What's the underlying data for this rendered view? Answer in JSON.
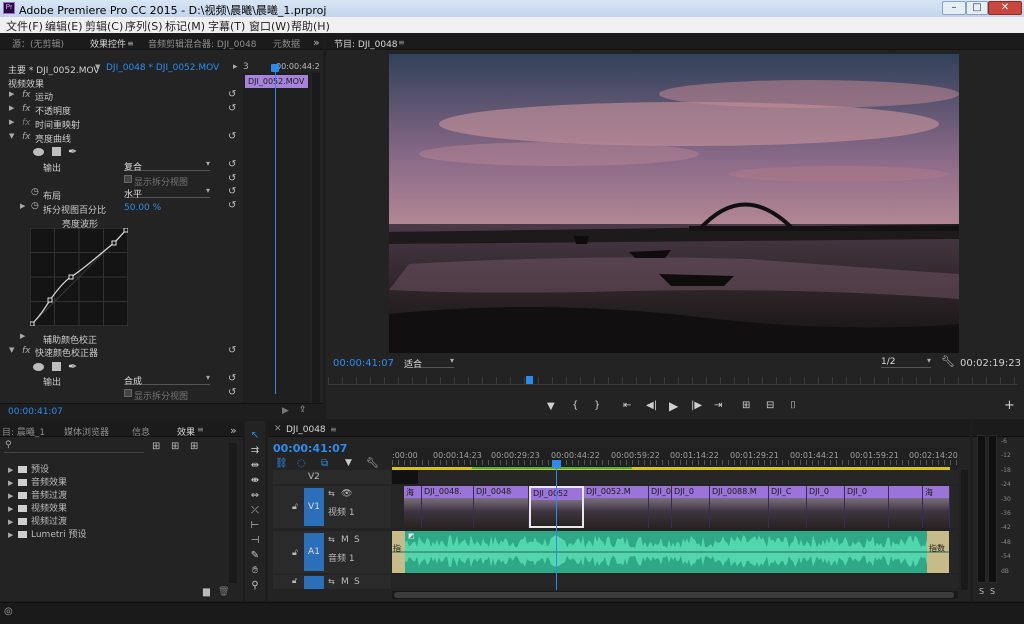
{
  "window": {
    "title": "Adobe Premiere Pro CC 2015 - D:\\视频\\晨曦\\晨曦_1.prproj",
    "app_icon": "Pr",
    "minimize": "–",
    "maximize": "□",
    "close": "✕"
  },
  "menu": [
    "文件(F)",
    "编辑(E)",
    "剪辑(C)",
    "序列(S)",
    "标记(M)",
    "字幕(T)",
    "窗口(W)",
    "帮助(H)"
  ],
  "effects_panel": {
    "tabs": [
      "源：(无剪辑)",
      "效果控件",
      "音频剪辑混合器: DJI_0048",
      "元数据"
    ],
    "overflow": "»",
    "master_label": "主要 * DJI_0052.MOV",
    "sequence_label": "DJI_0048 * DJI_0052.MOV",
    "ruler_start": "3",
    "ruler_time": "00:00:44:2",
    "clip_chip": "DJI_0052.MOV",
    "section": "视频效果",
    "effects": [
      {
        "name": "运动",
        "fx": "fx"
      },
      {
        "name": "不透明度",
        "fx": "fx"
      },
      {
        "name": "时间重映射",
        "fx": "fx"
      },
      {
        "name": "亮度曲线",
        "fx": "fx"
      }
    ],
    "output_label": "输出",
    "output_value": "复合",
    "split_view_label": "显示拆分视图",
    "layout_label": "布局",
    "layout_value": "水平",
    "split_percent_label": "拆分视图百分比",
    "split_percent_value": "50.00 %",
    "curve_title": "亮度波形",
    "aux_label": "辅助颜色校正",
    "fast_cc_label": "快速颜色校正器",
    "output2_label": "输出",
    "output2_value": "合成",
    "split_view2_label": "显示拆分视图",
    "timecode": "00:00:41:07"
  },
  "program_monitor": {
    "title": "节目: DJI_0048",
    "menu_icon": "≡",
    "timecode": "00:00:41:07",
    "fit": "适合",
    "resolution": "1/2",
    "duration": "00:02:19:23"
  },
  "project_panel": {
    "tabs": [
      "目: 晨曦_1",
      "媒体浏览器",
      "信息",
      "效果"
    ],
    "items": [
      "预设",
      "音频效果",
      "音频过渡",
      "视频效果",
      "视频过渡",
      "Lumetri 预设"
    ]
  },
  "timeline": {
    "tab": "DJI_0048",
    "timecode": "00:00:41:07",
    "ruler": [
      ":00:00",
      "00:00:14:23",
      "00:00:29:23",
      "00:00:44:22",
      "00:00:59:22",
      "00:01:14:22",
      "00:01:29:21",
      "00:01:44:21",
      "00:01:59:21",
      "00:02:14:20"
    ],
    "tracks": {
      "v2": "V2",
      "v1": "V1",
      "v1_name": "视频 1",
      "a1": "A1",
      "a1_name": "音频 1",
      "m": "M",
      "s": "S"
    },
    "clips": [
      "海",
      "DJI_0048.",
      "DJI_0048",
      "DJI_0052",
      "DJI_0052.M",
      "DJI_0",
      "DJI_0088.M",
      "DJI_C",
      "DJI_0",
      "DJI_0",
      ""
    ],
    "audio_start": "指",
    "audio_end": "指数"
  },
  "meter": {
    "labels": [
      "-6",
      "-12",
      "-18",
      "-24",
      "-30",
      "-36",
      "-42",
      "-48",
      "-54",
      "dB"
    ],
    "solo": [
      "S",
      "S"
    ]
  },
  "colors": {
    "accent": "#2d8ceb",
    "clip": "#9a74d8",
    "audio": "#2fa886"
  }
}
